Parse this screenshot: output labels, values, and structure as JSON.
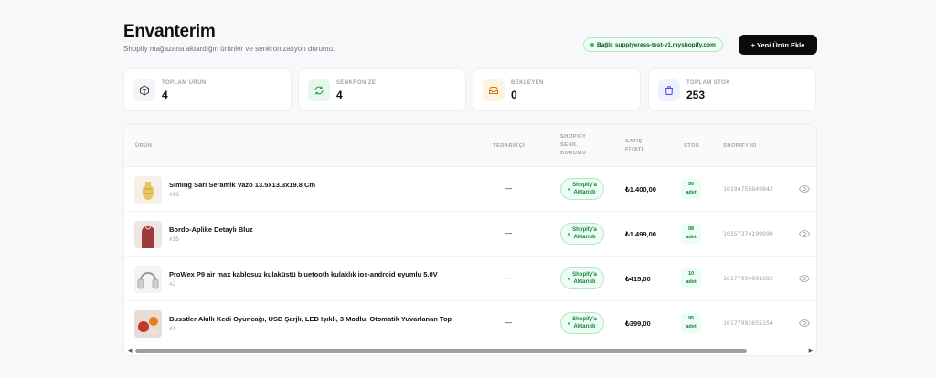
{
  "header": {
    "title": "Envanterim",
    "subtitle": "Shopify mağazana aktardığın ürünler ve senkronizasyon durumu."
  },
  "connection": {
    "label": "Bağlı: supplyeress-test-v1.myshopify.com"
  },
  "new_product_button": {
    "label": "+ Yeni Ürün Ekle"
  },
  "stats": [
    {
      "label": "TOPLAM ÜRÜN",
      "value": "4",
      "icon": "box-icon"
    },
    {
      "label": "SENKRONIZE",
      "value": "4",
      "icon": "refresh-icon"
    },
    {
      "label": "BEKLEYEN",
      "value": "0",
      "icon": "inbox-icon"
    },
    {
      "label": "TOPLAM STOK",
      "value": "253",
      "icon": "shopping-bag-icon"
    }
  ],
  "table": {
    "columns": {
      "product": "ÜRÜN",
      "supplier": "TEDARİKÇİ",
      "sync_line1": "SHOPIFY",
      "sync_line2": "SENK.",
      "sync_line3": "DURUMU",
      "price_line1": "SATIŞ",
      "price_line2": "FİYATI",
      "stock": "STOK",
      "shopify_id": "SHOPIFY ID"
    },
    "rows": [
      {
        "name": "Sımıng Sarı Seramik Vazo 13.5x13.3x19.8 Cm",
        "id": "#13",
        "supplier": "—",
        "sync_line1": "Shopify'a",
        "sync_line2": "Aktarıldı",
        "price": "₺1.400,00",
        "stock_qty": "50",
        "stock_unit": "adet",
        "shopify_id": "10194755849842",
        "thumb_color": "#e9c46a"
      },
      {
        "name": "Bordo-Aplike Detaylı Bluz",
        "id": "#15",
        "supplier": "—",
        "sync_line1": "Shopify'a",
        "sync_line2": "Aktarıldı",
        "price": "₺1.499,00",
        "stock_qty": "98",
        "stock_unit": "adet",
        "shopify_id": "10157374199090",
        "thumb_color": "#9b3b3b"
      },
      {
        "name": "ProWex P9 air max kablosuz kulaküstü bluetooth kulaklık ios-android uyumlu 5.0V",
        "id": "#2",
        "supplier": "—",
        "sync_line1": "Shopify'a",
        "sync_line2": "Aktarıldı",
        "price": "₺415,00",
        "stock_qty": "10",
        "stock_unit": "adet",
        "shopify_id": "10177994981682",
        "thumb_color": "#d6d6d6"
      },
      {
        "name": "Busstler Akıllı Kedi Oyuncağı, USB Şarjlı, LED Işıklı, 3 Modlu, Otomatik Yuvarlanan Top",
        "id": "#1",
        "supplier": "—",
        "sync_line1": "Shopify'a",
        "sync_line2": "Aktarıldı",
        "price": "₺399,00",
        "stock_qty": "95",
        "stock_unit": "adet",
        "shopify_id": "10177992655154",
        "thumb_color": "#c0392b"
      }
    ]
  },
  "scrollbar": {
    "left_arrow": "◀",
    "right_arrow": "▶",
    "position_fraction": 0.91
  }
}
